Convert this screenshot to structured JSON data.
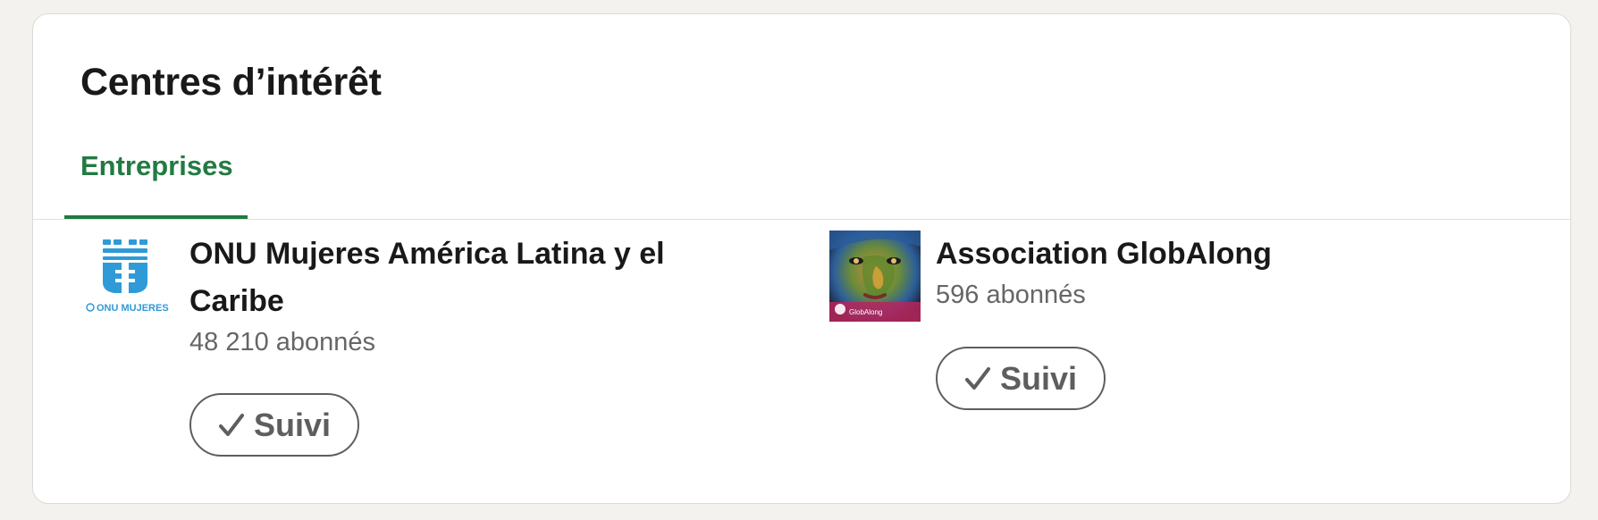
{
  "card": {
    "title": "Centres d’intérêt"
  },
  "tabs": [
    {
      "label": "Entreprises",
      "active": true
    }
  ],
  "entities": [
    {
      "name": "ONU Mujeres América Latina y el Caribe",
      "followers": "48 210 abonnés",
      "follow_label": "Suivi",
      "logo_text": "ONU MUJERES"
    },
    {
      "name": "Association GlobAlong",
      "followers": "596 abonnés",
      "follow_label": "Suivi",
      "logo_text": "GlobAlong"
    }
  ],
  "colors": {
    "accent_green": "#237a43",
    "text_primary": "#191919",
    "text_secondary": "#666666",
    "button_border": "#5e5e5e",
    "onu_blue": "#2f9ad8"
  },
  "icons": {
    "follow_button": "checkmark-icon"
  }
}
